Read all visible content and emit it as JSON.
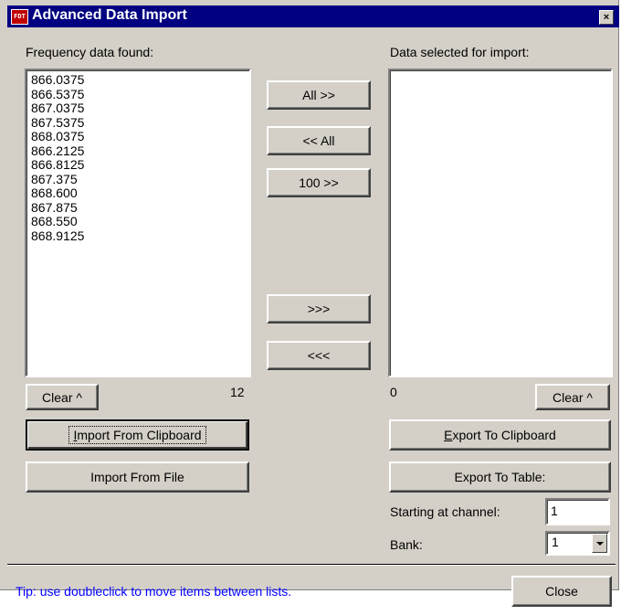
{
  "window": {
    "title": "Advanced Data Import",
    "icon_text": "FDT",
    "close_glyph": "×"
  },
  "left": {
    "label": "Frequency data found:",
    "items": [
      "866.0375",
      "866.5375",
      "867.0375",
      "867.5375",
      "868.0375",
      "866.2125",
      "866.8125",
      "867.375",
      "868.600",
      "867.875",
      "868.550",
      "868.9125"
    ],
    "count": "12",
    "clear_label": "Clear ^",
    "import_clipboard_pre": "",
    "import_clipboard_u": "I",
    "import_clipboard_post": "mport From Clipboard",
    "import_file_label": "Import From File"
  },
  "middle": {
    "all_right": "All >>",
    "all_left": "<< All",
    "hundred_right": "100 >>",
    "move_right": ">>>",
    "move_left": "<<<"
  },
  "right": {
    "label": "Data selected for import:",
    "items": [],
    "count": "0",
    "clear_label": "Clear ^",
    "export_clipboard_u": "E",
    "export_clipboard_post": "xport To Clipboard",
    "export_table_label": "Export To Table:",
    "starting_label": "Starting at channel:",
    "starting_value": "1",
    "bank_label": "Bank:",
    "bank_value": "1"
  },
  "footer": {
    "tip": "Tip: use doubleclick to move items between lists.",
    "close_label": "Close"
  },
  "colors": {
    "title_bar": "#000080",
    "face": "#d4d0c8",
    "tip": "#0000ff"
  }
}
